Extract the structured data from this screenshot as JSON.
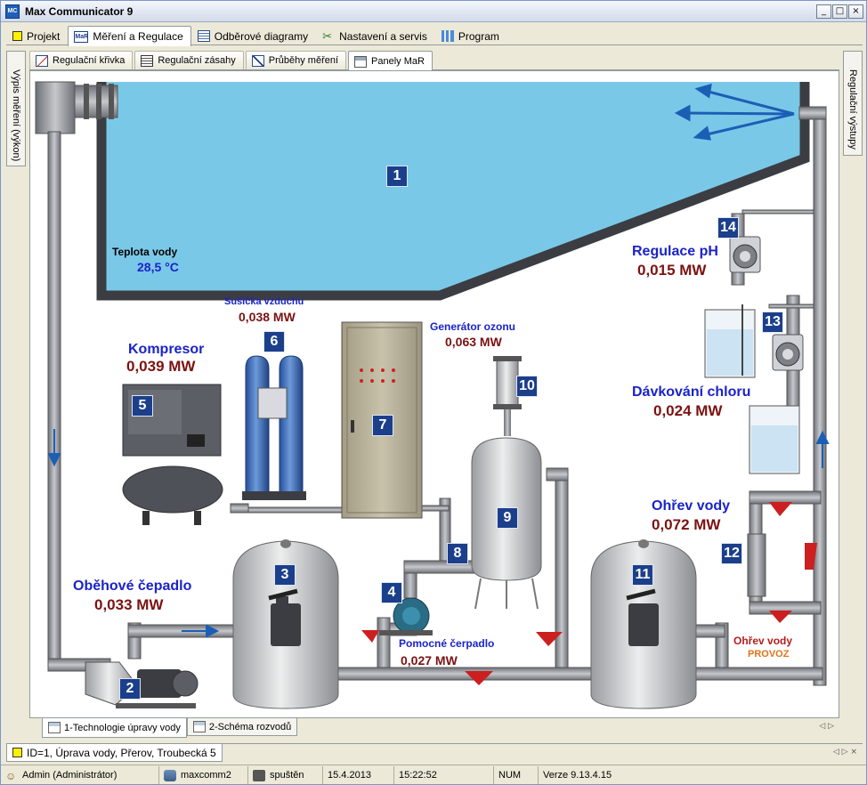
{
  "window": {
    "title": "Max Communicator 9",
    "app_icon": "MC",
    "colors": {
      "pool_water": "#7ac8e8",
      "pipe": "#8a8d93",
      "value_red": "#7b1212",
      "label_blue": "#1a23c9",
      "badge": "#1b3f8a",
      "status_orange": "#e0731c"
    }
  },
  "menu_tabs": [
    {
      "label": "Projekt",
      "icon": "yellow-square-icon"
    },
    {
      "label": "Měření a Regulace",
      "icon": "mar-icon"
    },
    {
      "label": "Odběrové diagramy",
      "icon": "table-icon"
    },
    {
      "label": "Nastavení a servis",
      "icon": "tools-icon"
    },
    {
      "label": "Program",
      "icon": "bars-icon"
    }
  ],
  "sub_tabs": [
    {
      "label": "Regulační křivka"
    },
    {
      "label": "Regulační zásahy"
    },
    {
      "label": "Průběhy měření"
    },
    {
      "label": "Panely MaR"
    }
  ],
  "side_left": "Výpis měření (výkon)",
  "side_right": "Regulační výstupy",
  "diagram": {
    "water_temp": {
      "label": "Teplota vody",
      "value": "28,5 °C"
    },
    "compressor": {
      "label": "Kompresor",
      "value": "0,039 MW"
    },
    "dryer": {
      "label": "Sušička vzduchu",
      "value": "0,038 MW"
    },
    "ozone": {
      "label": "Generátor ozonu",
      "value": "0,063 MW"
    },
    "circ_pump": {
      "label": "Oběhové čepadlo",
      "value": "0,033 MW"
    },
    "aux_pump": {
      "label": "Pomocné čerpadlo",
      "value": "0,027 MW"
    },
    "ph": {
      "label": "Regulace pH",
      "value": "0,015 MW"
    },
    "chlorine": {
      "label": "Dávkování chloru",
      "value": "0,024 MW"
    },
    "heating": {
      "label": "Ohřev vody",
      "value": "0,072 MW"
    },
    "heating_status": {
      "label": "Ohřev vody",
      "value": "PROVOZ"
    },
    "badges": [
      "1",
      "2",
      "3",
      "4",
      "5",
      "6",
      "7",
      "8",
      "9",
      "10",
      "11",
      "12",
      "13",
      "14"
    ]
  },
  "bottom_tabs": [
    {
      "label": "1-Technologie úpravy vody"
    },
    {
      "label": "2-Schéma rozvodů"
    }
  ],
  "doc_tab": "ID=1, Úprava vody, Přerov, Troubecká 5",
  "status": {
    "user": "Admin (Administrátor)",
    "db": "maxcomm2",
    "state": "spuštěn",
    "date": "15.4.2013",
    "time": "15:22:52",
    "caps": "NUM",
    "version": "Verze 9.13.4.15"
  }
}
